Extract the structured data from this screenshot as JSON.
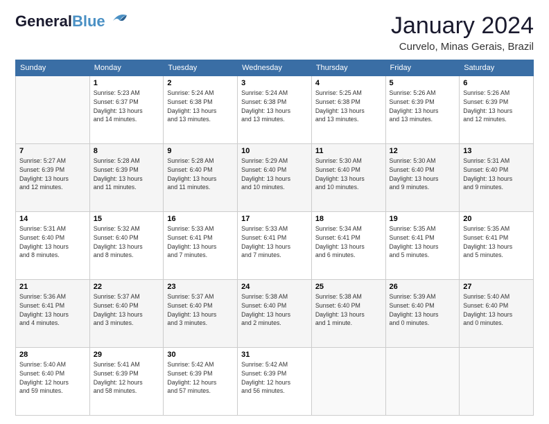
{
  "header": {
    "logo_line1": "General",
    "logo_line2": "Blue",
    "month": "January 2024",
    "location": "Curvelo, Minas Gerais, Brazil"
  },
  "days_of_week": [
    "Sunday",
    "Monday",
    "Tuesday",
    "Wednesday",
    "Thursday",
    "Friday",
    "Saturday"
  ],
  "weeks": [
    [
      {
        "day": "",
        "info": ""
      },
      {
        "day": "1",
        "info": "Sunrise: 5:23 AM\nSunset: 6:37 PM\nDaylight: 13 hours\nand 14 minutes."
      },
      {
        "day": "2",
        "info": "Sunrise: 5:24 AM\nSunset: 6:38 PM\nDaylight: 13 hours\nand 13 minutes."
      },
      {
        "day": "3",
        "info": "Sunrise: 5:24 AM\nSunset: 6:38 PM\nDaylight: 13 hours\nand 13 minutes."
      },
      {
        "day": "4",
        "info": "Sunrise: 5:25 AM\nSunset: 6:38 PM\nDaylight: 13 hours\nand 13 minutes."
      },
      {
        "day": "5",
        "info": "Sunrise: 5:26 AM\nSunset: 6:39 PM\nDaylight: 13 hours\nand 13 minutes."
      },
      {
        "day": "6",
        "info": "Sunrise: 5:26 AM\nSunset: 6:39 PM\nDaylight: 13 hours\nand 12 minutes."
      }
    ],
    [
      {
        "day": "7",
        "info": "Sunrise: 5:27 AM\nSunset: 6:39 PM\nDaylight: 13 hours\nand 12 minutes."
      },
      {
        "day": "8",
        "info": "Sunrise: 5:28 AM\nSunset: 6:39 PM\nDaylight: 13 hours\nand 11 minutes."
      },
      {
        "day": "9",
        "info": "Sunrise: 5:28 AM\nSunset: 6:40 PM\nDaylight: 13 hours\nand 11 minutes."
      },
      {
        "day": "10",
        "info": "Sunrise: 5:29 AM\nSunset: 6:40 PM\nDaylight: 13 hours\nand 10 minutes."
      },
      {
        "day": "11",
        "info": "Sunrise: 5:30 AM\nSunset: 6:40 PM\nDaylight: 13 hours\nand 10 minutes."
      },
      {
        "day": "12",
        "info": "Sunrise: 5:30 AM\nSunset: 6:40 PM\nDaylight: 13 hours\nand 9 minutes."
      },
      {
        "day": "13",
        "info": "Sunrise: 5:31 AM\nSunset: 6:40 PM\nDaylight: 13 hours\nand 9 minutes."
      }
    ],
    [
      {
        "day": "14",
        "info": "Sunrise: 5:31 AM\nSunset: 6:40 PM\nDaylight: 13 hours\nand 8 minutes."
      },
      {
        "day": "15",
        "info": "Sunrise: 5:32 AM\nSunset: 6:40 PM\nDaylight: 13 hours\nand 8 minutes."
      },
      {
        "day": "16",
        "info": "Sunrise: 5:33 AM\nSunset: 6:41 PM\nDaylight: 13 hours\nand 7 minutes."
      },
      {
        "day": "17",
        "info": "Sunrise: 5:33 AM\nSunset: 6:41 PM\nDaylight: 13 hours\nand 7 minutes."
      },
      {
        "day": "18",
        "info": "Sunrise: 5:34 AM\nSunset: 6:41 PM\nDaylight: 13 hours\nand 6 minutes."
      },
      {
        "day": "19",
        "info": "Sunrise: 5:35 AM\nSunset: 6:41 PM\nDaylight: 13 hours\nand 5 minutes."
      },
      {
        "day": "20",
        "info": "Sunrise: 5:35 AM\nSunset: 6:41 PM\nDaylight: 13 hours\nand 5 minutes."
      }
    ],
    [
      {
        "day": "21",
        "info": "Sunrise: 5:36 AM\nSunset: 6:41 PM\nDaylight: 13 hours\nand 4 minutes."
      },
      {
        "day": "22",
        "info": "Sunrise: 5:37 AM\nSunset: 6:40 PM\nDaylight: 13 hours\nand 3 minutes."
      },
      {
        "day": "23",
        "info": "Sunrise: 5:37 AM\nSunset: 6:40 PM\nDaylight: 13 hours\nand 3 minutes."
      },
      {
        "day": "24",
        "info": "Sunrise: 5:38 AM\nSunset: 6:40 PM\nDaylight: 13 hours\nand 2 minutes."
      },
      {
        "day": "25",
        "info": "Sunrise: 5:38 AM\nSunset: 6:40 PM\nDaylight: 13 hours\nand 1 minute."
      },
      {
        "day": "26",
        "info": "Sunrise: 5:39 AM\nSunset: 6:40 PM\nDaylight: 13 hours\nand 0 minutes."
      },
      {
        "day": "27",
        "info": "Sunrise: 5:40 AM\nSunset: 6:40 PM\nDaylight: 13 hours\nand 0 minutes."
      }
    ],
    [
      {
        "day": "28",
        "info": "Sunrise: 5:40 AM\nSunset: 6:40 PM\nDaylight: 12 hours\nand 59 minutes."
      },
      {
        "day": "29",
        "info": "Sunrise: 5:41 AM\nSunset: 6:39 PM\nDaylight: 12 hours\nand 58 minutes."
      },
      {
        "day": "30",
        "info": "Sunrise: 5:42 AM\nSunset: 6:39 PM\nDaylight: 12 hours\nand 57 minutes."
      },
      {
        "day": "31",
        "info": "Sunrise: 5:42 AM\nSunset: 6:39 PM\nDaylight: 12 hours\nand 56 minutes."
      },
      {
        "day": "",
        "info": ""
      },
      {
        "day": "",
        "info": ""
      },
      {
        "day": "",
        "info": ""
      }
    ]
  ]
}
